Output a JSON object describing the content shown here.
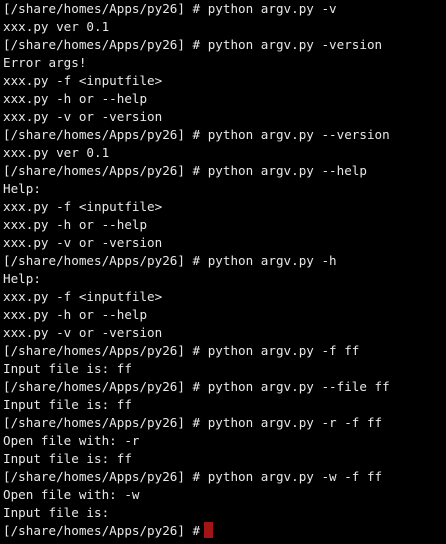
{
  "terminal": {
    "colors": {
      "background": "#000000",
      "foreground": "#e8e8e8",
      "cursor": "#a31515"
    },
    "lines": [
      "[/share/homes/Apps/py26] # python argv.py -v",
      "xxx.py ver 0.1",
      "[/share/homes/Apps/py26] # python argv.py -version",
      "Error args!",
      "xxx.py -f <inputfile>",
      "xxx.py -h or --help",
      "xxx.py -v or -version",
      "[/share/homes/Apps/py26] # python argv.py --version",
      "xxx.py ver 0.1",
      "[/share/homes/Apps/py26] # python argv.py --help",
      "Help:",
      "xxx.py -f <inputfile>",
      "xxx.py -h or --help",
      "xxx.py -v or -version",
      "[/share/homes/Apps/py26] # python argv.py -h",
      "Help:",
      "xxx.py -f <inputfile>",
      "xxx.py -h or --help",
      "xxx.py -v or -version",
      "[/share/homes/Apps/py26] # python argv.py -f ff",
      "Input file is: ff",
      "[/share/homes/Apps/py26] # python argv.py --file ff",
      "Input file is: ff",
      "[/share/homes/Apps/py26] # python argv.py -r -f ff",
      "Open file with: -r",
      "Input file is: ff",
      "[/share/homes/Apps/py26] # python argv.py -w -f ff",
      "Open file with: -w",
      "Input file is:"
    ],
    "prompt": "[/share/homes/Apps/py26] #"
  }
}
